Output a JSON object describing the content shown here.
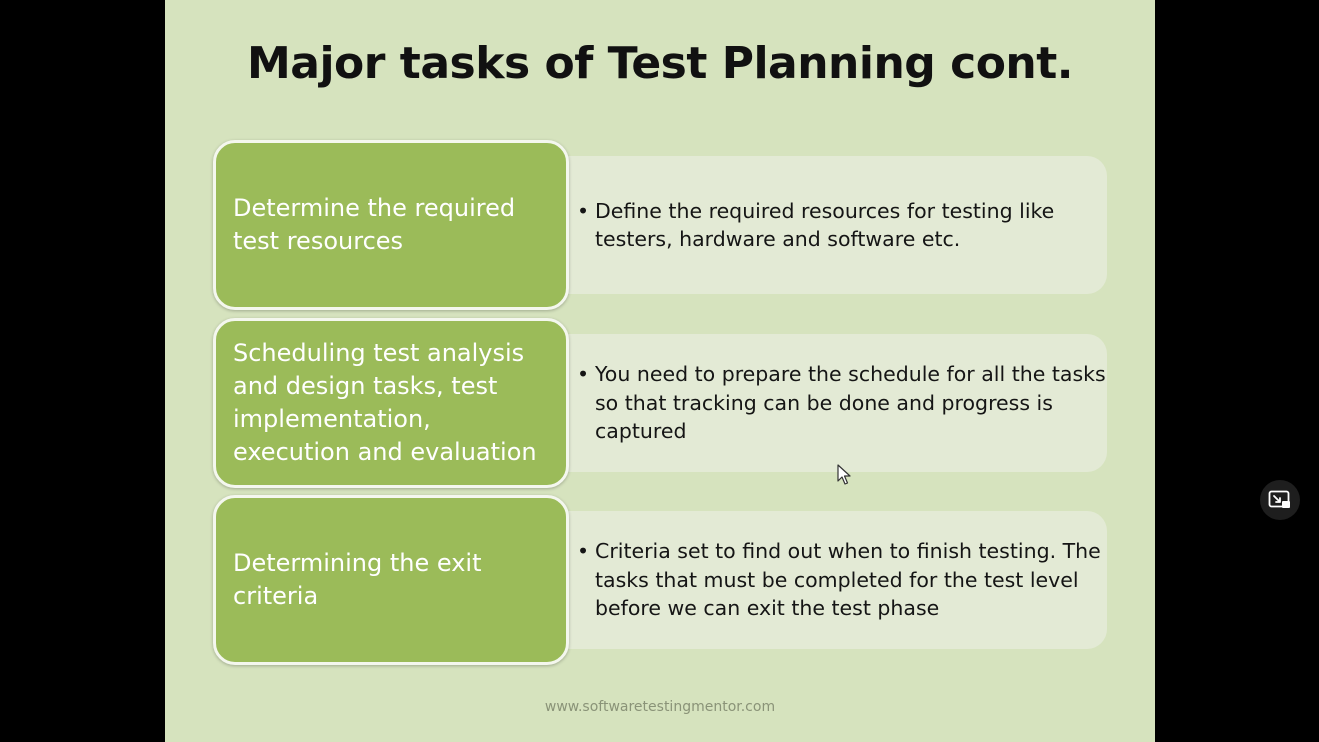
{
  "slide": {
    "title": "Major tasks of Test Planning cont.",
    "rows": [
      {
        "task": "Determine the required test resources",
        "bullet": "•",
        "description": "Define the required resources for testing like testers, hardware and software etc."
      },
      {
        "task": "Scheduling test analysis and design tasks, test implementation, execution and evaluation",
        "bullet": "•",
        "description": "You need to prepare the schedule for all the tasks so that tracking can be done and progress is captured"
      },
      {
        "task": "Determining the exit criteria",
        "bullet": "•",
        "description": "Criteria set to find out when to finish testing. The tasks that must be completed for the test level before we can exit the test phase"
      }
    ],
    "footer": "www.softwaretestingmentor.com"
  },
  "overlay": {
    "pip_icon": "picture-in-picture-icon",
    "cursor_icon": "mouse-pointer-icon"
  },
  "colors": {
    "slide_background": "#d6e3be",
    "task_box": "#9bbb59",
    "description_panel": "#e3ead5",
    "letterbox": "#000000"
  }
}
